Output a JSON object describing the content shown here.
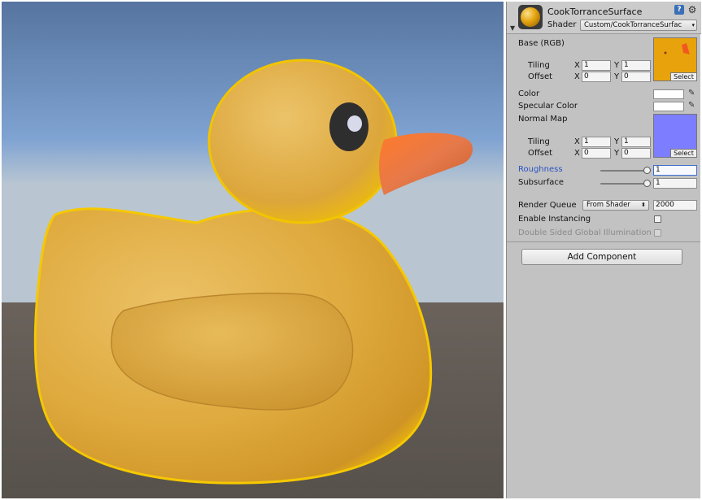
{
  "material": {
    "name": "CookTorranceSurface",
    "shader_label": "Shader",
    "shader_value": "Custom/CookTorranceSurfac",
    "icons": [
      "help-icon",
      "gear-icon"
    ]
  },
  "base": {
    "label": "Base (RGB)",
    "tiling_label": "Tiling",
    "offset_label": "Offset",
    "tiling": {
      "x": "1",
      "y": "1"
    },
    "offset": {
      "x": "0",
      "y": "0"
    },
    "select_label": "Select",
    "texture_color": "#e8a30c"
  },
  "axis": {
    "x": "X",
    "y": "Y"
  },
  "color": {
    "label": "Color",
    "value": "#ffffff"
  },
  "specular": {
    "label": "Specular Color",
    "value": "#ffffff"
  },
  "normal": {
    "label": "Normal Map",
    "tiling_label": "Tiling",
    "offset_label": "Offset",
    "tiling": {
      "x": "1",
      "y": "1"
    },
    "offset": {
      "x": "0",
      "y": "0"
    },
    "select_label": "Select",
    "texture_color": "#7d7dff"
  },
  "roughness": {
    "label": "Roughness",
    "value": "1",
    "level": 1.0
  },
  "subsurface": {
    "label": "Subsurface",
    "value": "1",
    "level": 1.0
  },
  "render_queue": {
    "label": "Render Queue",
    "mode": "From Shader",
    "value": "2000"
  },
  "instancing": {
    "label": "Enable Instancing",
    "checked": false
  },
  "double_sided": {
    "label": "Double Sided Global Illumination",
    "checked": false
  },
  "add_component": {
    "label": "Add Component"
  },
  "scene": {
    "sky_color": "#5e86be",
    "ground_color": "#5f5a55",
    "duck_color": "#e7b649",
    "beak_color": "#f0743a"
  }
}
